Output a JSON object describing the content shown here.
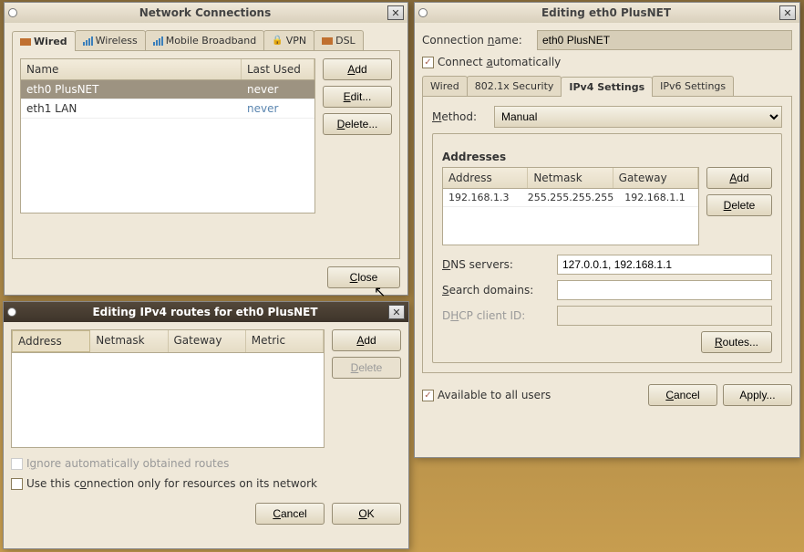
{
  "win_connections": {
    "title": "Network Connections",
    "tabs": {
      "wired": "Wired",
      "wireless": "Wireless",
      "mobile": "Mobile Broadband",
      "vpn": "VPN",
      "dsl": "DSL"
    },
    "columns": {
      "name": "Name",
      "last_used": "Last Used"
    },
    "rows": [
      {
        "name": "eth0 PlusNET",
        "last_used": "never",
        "selected": true
      },
      {
        "name": "eth1 LAN",
        "last_used": "never",
        "selected": false
      }
    ],
    "buttons": {
      "add": "Add",
      "edit": "Edit...",
      "delete": "Delete...",
      "close": "Close"
    }
  },
  "win_routes": {
    "title": "Editing IPv4 routes for eth0 PlusNET",
    "columns": {
      "address": "Address",
      "netmask": "Netmask",
      "gateway": "Gateway",
      "metric": "Metric"
    },
    "buttons": {
      "add": "Add",
      "delete": "Delete",
      "cancel": "Cancel",
      "ok": "OK"
    },
    "ignore_label": "Ignore automatically obtained routes",
    "only_label": "Use this connection only for resources on its network"
  },
  "win_edit": {
    "title": "Editing eth0 PlusNET",
    "conn_name_label": "Connection name:",
    "conn_name_value": "eth0 PlusNET",
    "auto_label": "Connect automatically",
    "tabs": {
      "wired": "Wired",
      "sec": "802.1x Security",
      "ipv4": "IPv4 Settings",
      "ipv6": "IPv6 Settings"
    },
    "method_label": "Method:",
    "method_value": "Manual",
    "addresses_label": "Addresses",
    "addr_cols": {
      "address": "Address",
      "netmask": "Netmask",
      "gateway": "Gateway"
    },
    "addr_rows": [
      {
        "address": "192.168.1.3",
        "netmask": "255.255.255.255",
        "gateway": "192.168.1.1"
      }
    ],
    "addr_buttons": {
      "add": "Add",
      "delete": "Delete"
    },
    "dns_label": "DNS servers:",
    "dns_value": "127.0.0.1, 192.168.1.1",
    "search_label": "Search domains:",
    "search_value": "",
    "dhcp_label": "DHCP client ID:",
    "routes_btn": "Routes...",
    "avail_label": "Available to all users",
    "buttons": {
      "cancel": "Cancel",
      "apply": "Apply..."
    }
  }
}
